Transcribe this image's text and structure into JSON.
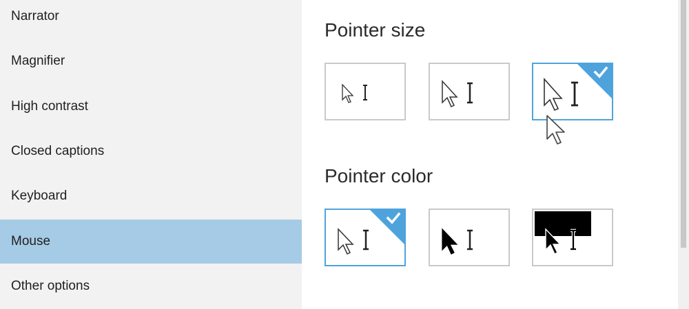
{
  "sidebar": {
    "items": [
      {
        "label": "Narrator"
      },
      {
        "label": "Magnifier"
      },
      {
        "label": "High contrast"
      },
      {
        "label": "Closed captions"
      },
      {
        "label": "Keyboard"
      },
      {
        "label": "Mouse",
        "selected": true
      },
      {
        "label": "Other options"
      }
    ]
  },
  "pointer_size": {
    "title": "Pointer size",
    "options": [
      {
        "icon": "small-pointer-icon",
        "selected": false
      },
      {
        "icon": "medium-pointer-icon",
        "selected": false
      },
      {
        "icon": "large-pointer-icon",
        "selected": true
      }
    ]
  },
  "pointer_color": {
    "title": "Pointer color",
    "options": [
      {
        "icon": "white-pointer-icon",
        "selected": true
      },
      {
        "icon": "black-pointer-icon",
        "selected": false
      },
      {
        "icon": "inverted-pointer-icon",
        "selected": false
      }
    ]
  },
  "colors": {
    "accent": "#4fa3dc",
    "selected_nav": "#a6cbe6",
    "sidebar_bg": "#f2f2f2"
  }
}
